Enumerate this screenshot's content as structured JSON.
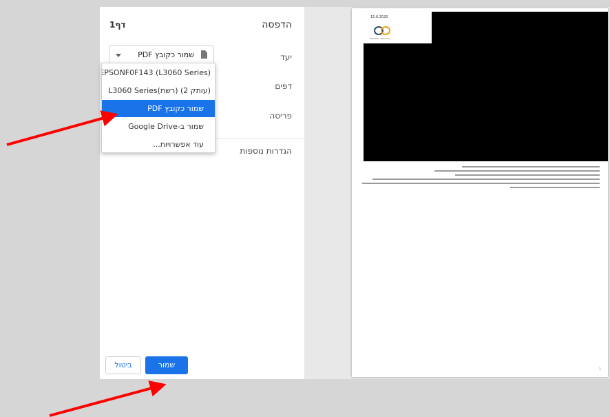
{
  "print_dialog": {
    "title": "הדפסה",
    "page_count": "דף1",
    "destination_label": "יעד",
    "destination_value": "שמור כקובץ PDF",
    "pages_label": "דפים",
    "layout_label": "פריסה",
    "more_settings": "הגדרות נוספות",
    "save_button": "שמור",
    "cancel_button": "ביטול"
  },
  "destination_dropdown": {
    "items": [
      {
        "label": "EPSONF0F143 (L3060 Series)"
      },
      {
        "label": "(עותק 2) (רשת)L3060 Series"
      },
      {
        "label": "שמור כקובץ PDF"
      },
      {
        "label": "שמור ב-Google Drive"
      },
      {
        "label": "עוד אפשרויות..."
      }
    ],
    "selected_index": 2
  },
  "preview": {
    "date": "15.6.2020",
    "logo_text": "בית ספר אופטימי",
    "page_number": "1"
  },
  "colors": {
    "accent": "#1a73e8",
    "arrow": "#ff0000",
    "logo_primary": "#2e4b68",
    "logo_secondary": "#e8a317"
  }
}
